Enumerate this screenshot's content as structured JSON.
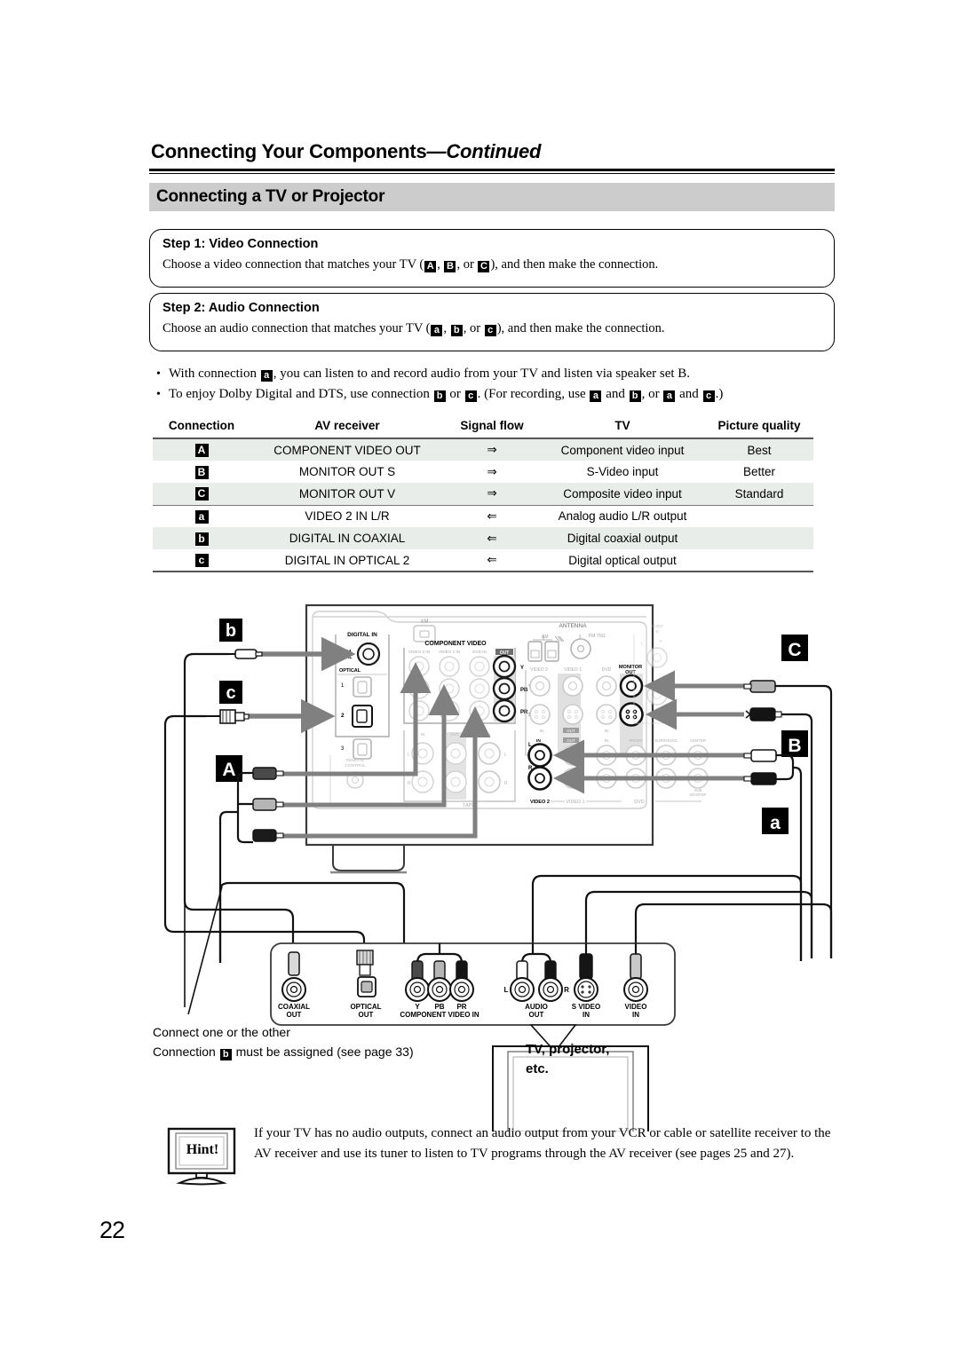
{
  "header": {
    "chapter_title": "Connecting Your Components",
    "chapter_title_suffix": "—Continued",
    "section_title": "Connecting a TV or Projector"
  },
  "steps": [
    {
      "heading": "Step 1: Video Connection",
      "text_before": "Choose a video connection that matches your TV (",
      "badge1": "A",
      "sep1": ", ",
      "badge2": "B",
      "sep2": ", or ",
      "badge3": "C",
      "text_after": "), and then make the connection."
    },
    {
      "heading": "Step 2: Audio Connection",
      "text_before": "Choose an audio connection that matches your TV (",
      "badge1": "a",
      "sep1": ", ",
      "badge2": "b",
      "sep2": ", or ",
      "badge3": "c",
      "text_after": "), and then make the connection."
    }
  ],
  "bullets": [
    {
      "p1": "With connection ",
      "b1": "a",
      "p2": ", you can listen to and record audio from your TV and listen via speaker set B."
    },
    {
      "p1": "To enjoy Dolby Digital and DTS, use connection ",
      "b1": "b",
      "p2": " or ",
      "b2": "c",
      "p3": ". (For recording, use ",
      "b3": "a",
      "p4": " and ",
      "b4": "b",
      "p5": ", or ",
      "b5": "a",
      "p6": " and ",
      "b6": "c",
      "p7": ".)"
    }
  ],
  "table": {
    "headers": [
      "Connection",
      "AV receiver",
      "Signal flow",
      "TV",
      "Picture quality"
    ],
    "rows": [
      {
        "connection": "A",
        "av_receiver": "COMPONENT VIDEO OUT",
        "signal_flow": "⇒",
        "tv": "Component video input",
        "picture_quality": "Best",
        "shaded": true
      },
      {
        "connection": "B",
        "av_receiver": "MONITOR OUT S",
        "signal_flow": "⇒",
        "tv": "S-Video input",
        "picture_quality": "Better",
        "shaded": false
      },
      {
        "connection": "C",
        "av_receiver": "MONITOR OUT V",
        "signal_flow": "⇒",
        "tv": "Composite video input",
        "picture_quality": "Standard",
        "shaded": true
      },
      {
        "connection": "a",
        "av_receiver": "VIDEO 2 IN L/R",
        "signal_flow": "⇐",
        "tv": "Analog audio L/R output",
        "picture_quality": "",
        "shaded": false
      },
      {
        "connection": "b",
        "av_receiver": "DIGITAL IN COAXIAL",
        "signal_flow": "⇐",
        "tv": "Digital coaxial output",
        "picture_quality": "",
        "shaded": true
      },
      {
        "connection": "c",
        "av_receiver": "DIGITAL IN OPTICAL 2",
        "signal_flow": "⇐",
        "tv": "Digital optical output",
        "picture_quality": "",
        "shaded": false
      }
    ]
  },
  "diagram": {
    "callout_labels": {
      "b": "b",
      "c": "c",
      "A": "A",
      "C": "C",
      "B": "B",
      "a": "a"
    },
    "receiver_panel": {
      "digital_in": "DIGITAL IN",
      "coaxial": "COAXIAL",
      "coaxial_line1": "COA",
      "coaxial_line2": "XIAL",
      "optical": "OPTICAL",
      "optical_ports": [
        "1",
        "2",
        "3"
      ],
      "xm": "XM",
      "component_video": "COMPONENT VIDEO",
      "component_sources": [
        "VIDEO 2 IN",
        "VIDEO 1 IN",
        "DVD IN"
      ],
      "component_out": "OUT",
      "component_rows": [
        "Y",
        "PB",
        "PR"
      ],
      "antenna": "ANTENNA",
      "antenna_am": "AM",
      "antenna_fm": "FM 75Ω",
      "monitor_out": "MONITOR OUT",
      "video_groups": [
        "VIDEO 2",
        "VIDEO 1",
        "DVD"
      ],
      "jack_rows": [
        "Y",
        "S",
        "L",
        "R"
      ],
      "in_label": "IN",
      "out_label": "OUT",
      "speaker_labels": [
        "FRONT",
        "SURROUND",
        "CENTER",
        "SUB WOOFER"
      ],
      "surround_back": "SURR B",
      "remote_control": "REMOTE CONTROL",
      "cd": "CD",
      "tape": "TAPE"
    },
    "tv_panel": {
      "jacks": [
        {
          "label1": "COAXIAL",
          "label2": "OUT"
        },
        {
          "label1": "OPTICAL",
          "label2": "OUT"
        },
        {
          "label1": "Y",
          "label2": ""
        },
        {
          "label1": "PB",
          "label2": ""
        },
        {
          "label1": "PR",
          "label2": ""
        },
        {
          "label1": "AUDIO",
          "label2": "OUT"
        },
        {
          "label1": "S VIDEO",
          "label2": "IN"
        },
        {
          "label1": "VIDEO",
          "label2": "IN"
        }
      ],
      "component_group": "COMPONENT VIDEO IN",
      "audio_l": "L",
      "audio_r": "R"
    },
    "tv_box_line1": "TV, projector,",
    "tv_box_line2": "etc."
  },
  "notes": {
    "line1": "Connect one or the other",
    "line2_p1": "Connection ",
    "line2_badge": "b",
    "line2_p2": " must be assigned (see page 33)"
  },
  "hint": {
    "label": "Hint!",
    "text": "If your TV has no audio outputs, connect an audio output from your VCR or cable or satellite receiver to the AV receiver and use its tuner to listen to TV programs through the AV receiver (see pages 25 and 27)."
  },
  "page_number": "22",
  "colors": {
    "section_bar": "#cccccc",
    "table_shade": "#e9edea",
    "badge_bg": "#000000",
    "arrow_gray": "#808080"
  }
}
